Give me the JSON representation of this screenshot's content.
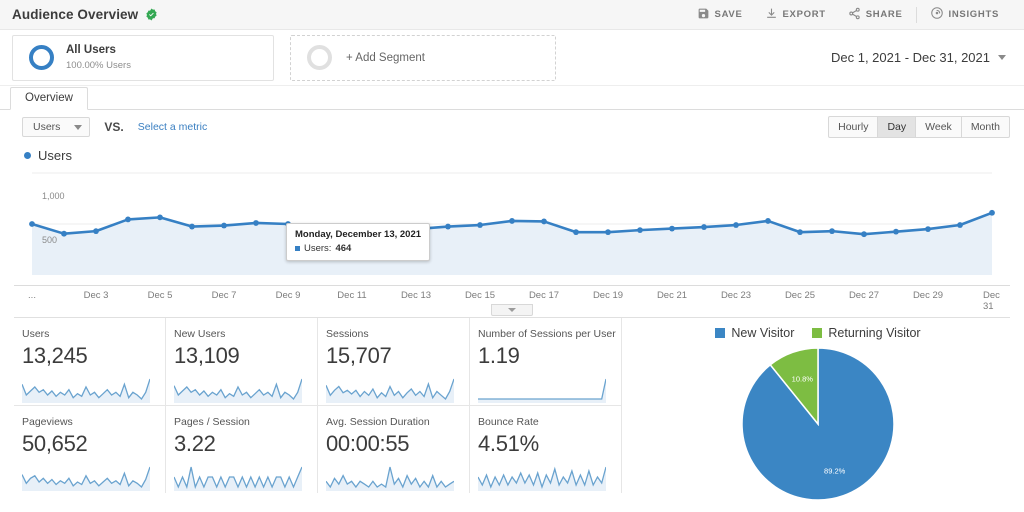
{
  "header": {
    "title": "Audience Overview",
    "verified_icon": "verified-badge-icon",
    "actions": [
      {
        "label": "SAVE",
        "icon": "save-icon"
      },
      {
        "label": "EXPORT",
        "icon": "export-icon"
      },
      {
        "label": "SHARE",
        "icon": "share-icon"
      },
      {
        "label": "INSIGHTS",
        "icon": "insights-icon"
      }
    ]
  },
  "segments": {
    "all_users": {
      "name": "All Users",
      "sub": "100.00% Users",
      "icon": "segment-ring-icon"
    },
    "add_segment": {
      "label": "+ Add Segment",
      "icon": "segment-ring-empty-icon"
    }
  },
  "date_range": {
    "label": "Dec 1, 2021 - Dec 31, 2021",
    "icon": "chevron-down-icon"
  },
  "tabs": [
    {
      "label": "Overview",
      "active": true
    }
  ],
  "metric_selector": {
    "primary_metric": "Users",
    "vs_label": "VS.",
    "secondary_link": "Select a metric",
    "dropdown_icon": "chevron-down-icon"
  },
  "granularity": {
    "options": [
      "Hourly",
      "Day",
      "Week",
      "Month"
    ],
    "selected": "Day"
  },
  "chart_legend": {
    "label": "Users",
    "color": "#3680c4"
  },
  "tooltip": {
    "title": "Monday, December 13, 2021",
    "series_label": "Users:",
    "value": "464"
  },
  "drag_handle_icon": "drag-handle-icon",
  "cards": [
    {
      "label": "Users",
      "value": "13,245"
    },
    {
      "label": "New Users",
      "value": "13,109"
    },
    {
      "label": "Sessions",
      "value": "15,707"
    },
    {
      "label": "Number of Sessions per User",
      "value": "1.19"
    },
    {
      "label": "Pageviews",
      "value": "50,652"
    },
    {
      "label": "Pages / Session",
      "value": "3.22"
    },
    {
      "label": "Avg. Session Duration",
      "value": "00:00:55"
    },
    {
      "label": "Bounce Rate",
      "value": "4.51%"
    }
  ],
  "colors": {
    "accent_blue": "#3680c4",
    "pie_blue": "#3b86c4",
    "pie_green": "#7dbd42",
    "link_blue": "#3a7fc1",
    "verified_green": "#34a853"
  },
  "chart_data": [
    {
      "type": "line",
      "title": "Users",
      "xlabel": "",
      "ylabel": "Users",
      "ylim": [
        0,
        1000
      ],
      "yticks": [
        500,
        1000
      ],
      "ytick_labels": [
        "500",
        "1,000"
      ],
      "grid": true,
      "legend": "top-left",
      "x_axis_labels": [
        "...",
        "Dec 3",
        "Dec 5",
        "Dec 7",
        "Dec 9",
        "Dec 11",
        "Dec 13",
        "Dec 15",
        "Dec 17",
        "Dec 19",
        "Dec 21",
        "Dec 23",
        "Dec 25",
        "Dec 27",
        "Dec 29",
        "Dec 31"
      ],
      "x": [
        "Dec 1",
        "Dec 2",
        "Dec 3",
        "Dec 4",
        "Dec 5",
        "Dec 6",
        "Dec 7",
        "Dec 8",
        "Dec 9",
        "Dec 10",
        "Dec 11",
        "Dec 12",
        "Dec 13",
        "Dec 14",
        "Dec 15",
        "Dec 16",
        "Dec 17",
        "Dec 18",
        "Dec 19",
        "Dec 20",
        "Dec 21",
        "Dec 22",
        "Dec 23",
        "Dec 24",
        "Dec 25",
        "Dec 26",
        "Dec 27",
        "Dec 28",
        "Dec 29",
        "Dec 30",
        "Dec 31"
      ],
      "values": [
        500,
        405,
        430,
        545,
        565,
        475,
        485,
        510,
        500,
        464,
        455,
        425,
        450,
        475,
        490,
        530,
        525,
        420,
        420,
        440,
        455,
        470,
        490,
        530,
        420,
        430,
        400,
        425,
        450,
        490,
        610
      ],
      "highlighted_point": {
        "x": "Dec 13",
        "y": 464
      }
    },
    {
      "type": "pie",
      "title": "",
      "labels": [
        "New Visitor",
        "Returning Visitor"
      ],
      "values": [
        89.2,
        10.8
      ],
      "value_labels": [
        "89.2%",
        "10.8%"
      ],
      "colors": [
        "#3b86c4",
        "#7dbd42"
      ],
      "legend": "top"
    },
    {
      "type": "line",
      "title": "Users sparkline",
      "values": [
        30,
        22,
        25,
        28,
        24,
        26,
        22,
        25,
        21,
        24,
        22,
        26,
        20,
        23,
        21,
        28,
        22,
        24,
        20,
        23,
        26,
        22,
        24,
        21,
        30,
        20,
        24,
        22,
        19,
        24,
        34
      ]
    },
    {
      "type": "line",
      "title": "New Users sparkline",
      "values": [
        28,
        21,
        24,
        27,
        23,
        25,
        21,
        24,
        20,
        23,
        21,
        25,
        19,
        22,
        20,
        27,
        21,
        23,
        19,
        22,
        25,
        21,
        23,
        20,
        29,
        19,
        23,
        21,
        18,
        23,
        33
      ]
    },
    {
      "type": "line",
      "title": "Sessions sparkline",
      "values": [
        29,
        21,
        25,
        28,
        23,
        25,
        22,
        25,
        20,
        24,
        21,
        26,
        19,
        23,
        20,
        28,
        21,
        24,
        19,
        23,
        26,
        21,
        24,
        20,
        30,
        19,
        24,
        21,
        18,
        24,
        34
      ]
    },
    {
      "type": "line",
      "title": "Sessions per User sparkline",
      "values": [
        20,
        20,
        20,
        20,
        20,
        20,
        20,
        20,
        20,
        20,
        20,
        20,
        20,
        20,
        20,
        20,
        20,
        20,
        20,
        20,
        20,
        20,
        20,
        20,
        20,
        20,
        20,
        20,
        20,
        20,
        21
      ]
    },
    {
      "type": "line",
      "title": "Pageviews sparkline",
      "values": [
        29,
        22,
        26,
        28,
        23,
        26,
        22,
        25,
        21,
        24,
        22,
        26,
        20,
        23,
        21,
        28,
        22,
        24,
        20,
        23,
        26,
        22,
        24,
        21,
        30,
        20,
        24,
        22,
        19,
        25,
        35
      ]
    },
    {
      "type": "line",
      "title": "Pages / Session sparkline",
      "values": [
        22,
        21,
        22,
        21,
        23,
        21,
        22,
        21,
        22,
        22,
        21,
        22,
        21,
        22,
        22,
        21,
        22,
        21,
        22,
        21,
        22,
        21,
        22,
        21,
        22,
        22,
        21,
        22,
        21,
        22,
        23
      ]
    },
    {
      "type": "line",
      "title": "Avg. Session Duration sparkline",
      "values": [
        24,
        22,
        25,
        23,
        26,
        23,
        24,
        22,
        24,
        23,
        22,
        24,
        22,
        23,
        22,
        29,
        23,
        25,
        22,
        26,
        23,
        25,
        22,
        24,
        22,
        26,
        22,
        24,
        22,
        23,
        24
      ]
    },
    {
      "type": "line",
      "title": "Bounce Rate sparkline",
      "values": [
        26,
        22,
        27,
        21,
        26,
        22,
        27,
        22,
        26,
        23,
        28,
        23,
        27,
        22,
        28,
        21,
        27,
        23,
        30,
        22,
        26,
        23,
        29,
        22,
        27,
        22,
        29,
        22,
        26,
        23,
        31
      ]
    }
  ]
}
